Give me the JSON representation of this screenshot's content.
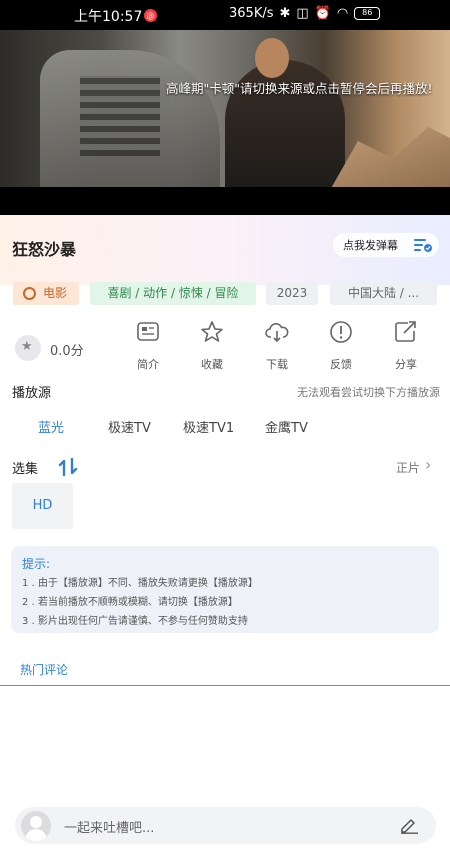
{
  "status_bar": {
    "time": "上午10:57",
    "notification_badge": "@",
    "net_speed": "365K/s",
    "battery": "86"
  },
  "video": {
    "message": "高峰期\"卡顿\"请切换来源或点击暂停会后再播放!"
  },
  "title": "狂怒沙暴",
  "danmu_button": "点我发弹幕",
  "tags": {
    "type": "电影",
    "genres": "喜剧 / 动作 / 惊悚 / 冒险",
    "year": "2023",
    "region": "中国大陆 / ..."
  },
  "rating": "0.0分",
  "actions": [
    {
      "icon": "intro-icon",
      "label": "简介"
    },
    {
      "icon": "star-icon",
      "label": "收藏"
    },
    {
      "icon": "cloud-download-icon",
      "label": "下载"
    },
    {
      "icon": "feedback-icon",
      "label": "反馈"
    },
    {
      "icon": "share-icon",
      "label": "分享"
    }
  ],
  "source_section": {
    "label": "播放源",
    "hint": "无法观看尝试切换下方播放源"
  },
  "sources": [
    "蓝光",
    "极速TV",
    "极速TV1",
    "金鹰TV"
  ],
  "episodes": {
    "label": "选集",
    "link": "正片",
    "items": [
      "HD"
    ]
  },
  "tips": {
    "title": "提示:",
    "lines": [
      "1 . 由于【播放源】不同、播放失败请更换【播放源】",
      "2 . 若当前播放不顺畅或模糊、请切换【播放源】",
      "3 . 影片出现任何广告请谨慎、不参与任何赞助支持"
    ]
  },
  "hot_comments": "热门评论",
  "comment_input": {
    "placeholder": "一起来吐槽吧..."
  },
  "colors": {
    "accent": "#2f7fd8"
  }
}
